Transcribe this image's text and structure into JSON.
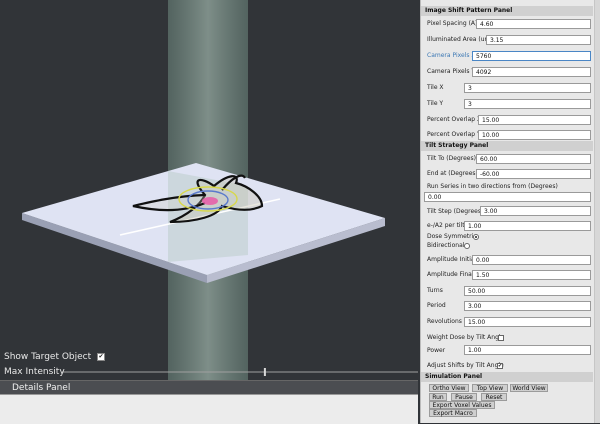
{
  "viewport": {
    "show_target_label": "Show Target Object",
    "show_target_checked": true,
    "max_intensity_label": "Max Intensity",
    "max_intensity_fraction": 0.57,
    "details_title": "Details Panel"
  },
  "image_shift": {
    "title": "Image Shift Pattern Panel",
    "fields": [
      {
        "label": "Pixel Spacing (A)",
        "value": "4.60"
      },
      {
        "label": "Illuminated Area (um)",
        "value": "3.15"
      },
      {
        "label": "Camera Pixels X",
        "value": "5760"
      },
      {
        "label": "Camera Pixels Y",
        "value": "4092"
      },
      {
        "label": "Tile X",
        "value": "3"
      },
      {
        "label": "Tile Y",
        "value": "3"
      },
      {
        "label": "Percent Overlap X",
        "value": "15.00"
      },
      {
        "label": "Percent Overlap Y",
        "value": "10.00"
      }
    ]
  },
  "tilt": {
    "title": "Tilt Strategy Panel",
    "tilt_to_label": "Tilt To (Degrees)",
    "tilt_to_value": "60.00",
    "end_at_label": "End at (Degrees)",
    "end_at_value": "-60.00",
    "run_series_label": "Run Series in two directions from (Degrees)",
    "run_series_value": "0.00",
    "tilt_step_label": "Tilt Step (Degrees)",
    "tilt_step_value": "3.00",
    "e_per_tilt_label": "e-/A2 per tilt",
    "e_per_tilt_value": "1.00",
    "dose_symmetric_label": "Dose Symmetric",
    "dose_symmetric_on": true,
    "bidirectional_label": "Bidirectional",
    "bidirectional_on": false,
    "fields": [
      {
        "label": "Amplitude Initial",
        "value": "0.00"
      },
      {
        "label": "Amplitude Final",
        "value": "1.50"
      },
      {
        "label": "Turns",
        "value": "50.00"
      },
      {
        "label": "Period",
        "value": "3.00"
      },
      {
        "label": "Revolutions",
        "value": "15.00"
      }
    ],
    "weight_dose_label": "Weight Dose by Tilt Angle",
    "weight_dose_checked": false,
    "power_label": "Power",
    "power_value": "1.00",
    "adjust_shifts_label": "Adjust Shifts by Tilt Angle",
    "adjust_shifts_checked": true
  },
  "simulation": {
    "title": "Simulation Panel",
    "ortho_view": "Ortho View",
    "top_view": "Top View",
    "world_view": "World View",
    "run": "Run",
    "pause": "Pause",
    "reset": "Reset",
    "export_voxel": "Export Voxel Values",
    "export_macro": "Export Macro"
  }
}
